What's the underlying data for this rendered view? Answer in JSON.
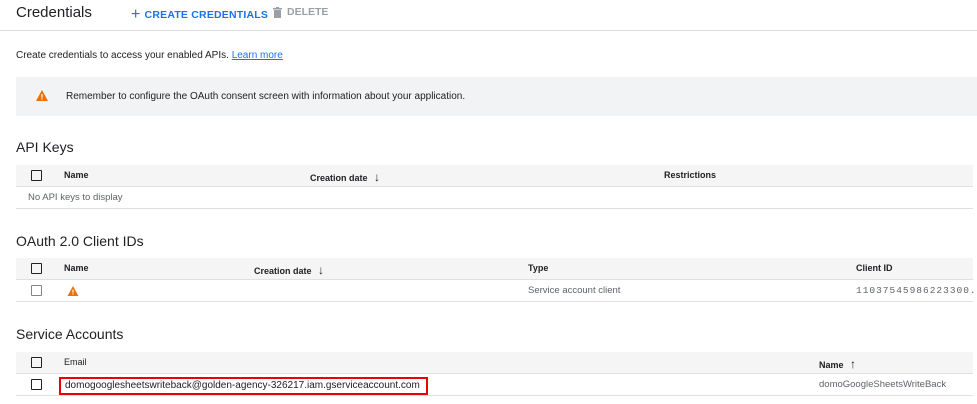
{
  "header": {
    "title": "Credentials",
    "create_label": "CREATE CREDENTIALS",
    "delete_label": "DELETE"
  },
  "intro": {
    "text": "Create credentials to access your enabled APIs.",
    "link": "Learn more"
  },
  "banner": {
    "message": "Remember to configure the OAuth consent screen with information about your application."
  },
  "api_keys": {
    "heading": "API Keys",
    "columns": [
      "Name",
      "Creation date",
      "Restrictions"
    ],
    "empty": "No API keys to display"
  },
  "oauth": {
    "heading": "OAuth 2.0 Client IDs",
    "columns": [
      "Name",
      "Creation date",
      "Type",
      "Client ID"
    ],
    "rows": [
      {
        "name": "",
        "type": "Service account client",
        "client_id": "11037545986223300..."
      }
    ]
  },
  "service_accounts": {
    "heading": "Service Accounts",
    "columns": [
      "Email",
      "Name"
    ],
    "rows": [
      {
        "email": "domogooglesheetswriteback@golden-agency-326217.iam.gserviceaccount.com",
        "name": "domoGoogleSheetsWriteBack"
      }
    ]
  },
  "colors": {
    "accent": "#1a73e8",
    "warning": "#e8710a",
    "highlight": "#ee0000"
  }
}
